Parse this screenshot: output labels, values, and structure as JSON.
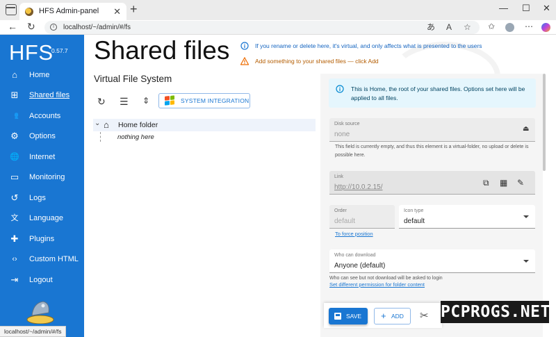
{
  "browser": {
    "tab_title": "HFS Admin-panel",
    "tab_close": "✕",
    "new_tab": "+",
    "url": "localhost/~/admin/#/fs",
    "status_url": "localhost/~/admin/#/fs"
  },
  "sidebar": {
    "logo": "HFS",
    "version": "0.57.7",
    "items": [
      {
        "label": "Home",
        "icon": "home-icon",
        "glyph": "⌂"
      },
      {
        "label": "Shared files",
        "icon": "sitemap-icon",
        "glyph": "⊞"
      },
      {
        "label": "Accounts",
        "icon": "accounts-icon",
        "glyph": "👥"
      },
      {
        "label": "Options",
        "icon": "gear-icon",
        "glyph": "⚙"
      },
      {
        "label": "Internet",
        "icon": "globe-icon",
        "glyph": "🌐"
      },
      {
        "label": "Monitoring",
        "icon": "monitor-icon",
        "glyph": "▭"
      },
      {
        "label": "Logs",
        "icon": "history-icon",
        "glyph": "↺"
      },
      {
        "label": "Language",
        "icon": "translate-icon",
        "glyph": "文"
      },
      {
        "label": "Plugins",
        "icon": "puzzle-icon",
        "glyph": "✚"
      },
      {
        "label": "Custom HTML",
        "icon": "code-icon",
        "glyph": "‹›"
      },
      {
        "label": "Logout",
        "icon": "logout-icon",
        "glyph": "⇥"
      }
    ]
  },
  "main": {
    "title": "Shared files",
    "hints": [
      "If you rename or delete here, it's virtual, and only affects what is presented to the users",
      "Add something to your shared files — click Add"
    ],
    "vfs_title": "Virtual File System",
    "system_integration": "SYSTEM INTEGRATION",
    "tree": {
      "root": "Home folder",
      "empty": "nothing here"
    }
  },
  "details": {
    "info": "This is Home, the root of your shared files. Options set here will be applied to all files.",
    "disk_source": {
      "label": "Disk source",
      "value": "none",
      "helper": "This field is currently empty, and thus this element is a virtual-folder, no upload or delete is possible here."
    },
    "link": {
      "label": "Link",
      "value": "http://10.0.2.15/"
    },
    "order": {
      "label": "Order",
      "placeholder": "default",
      "force_link": "To force position"
    },
    "icon_type": {
      "label": "Icon type",
      "value": "default"
    },
    "can_download": {
      "label": "Who can download",
      "value": "Anyone (default)",
      "helper": "Who can see but not download will be asked to login",
      "perm_link": "Set different permission for folder content"
    }
  },
  "actions": {
    "save": "SAVE",
    "add": "ADD"
  },
  "watermark": "PCPROGS.NET",
  "colors": {
    "primary": "#1976d2",
    "info_bg": "#e5f6fd",
    "warning": "#ed6c02"
  }
}
